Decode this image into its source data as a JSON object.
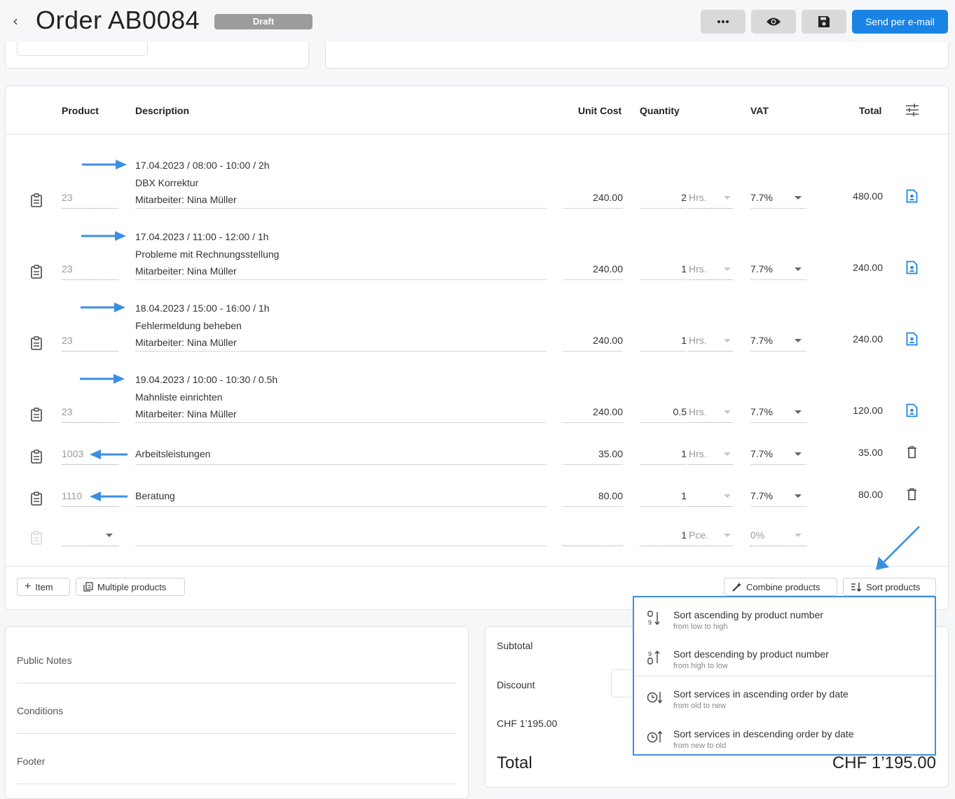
{
  "header": {
    "title": "Order AB0084",
    "status": "Draft",
    "send_label": "Send per e-mail",
    "more_icon": "ellipsis-icon",
    "preview_icon": "eye-icon",
    "save_icon": "floppy-disk-icon"
  },
  "table": {
    "columns": {
      "product": "Product",
      "description": "Description",
      "unit_cost": "Unit Cost",
      "quantity": "Quantity",
      "vat": "VAT",
      "total": "Total"
    },
    "rows": [
      {
        "product": "23",
        "date": "17.04.2023 / 08:00 - 10:00 / 2h",
        "title": "DBX Korrektur",
        "employee": "Mitarbeiter: Nina Müller",
        "unit_cost": "240.00",
        "qty": "2",
        "unit": "Hrs.",
        "vat": "7.7%",
        "total": "480.00"
      },
      {
        "product": "23",
        "date": "17.04.2023 / 11:00 - 12:00 / 1h",
        "title": "Probleme mit Rechnungsstellung",
        "employee": "Mitarbeiter: Nina Müller",
        "unit_cost": "240.00",
        "qty": "1",
        "unit": "Hrs.",
        "vat": "7.7%",
        "total": "240.00"
      },
      {
        "product": "23",
        "date": "18.04.2023 / 15:00 - 16:00 / 1h",
        "title": "Fehlermeldung beheben",
        "employee": "Mitarbeiter: Nina Müller",
        "unit_cost": "240.00",
        "qty": "1",
        "unit": "Hrs.",
        "vat": "7.7%",
        "total": "240.00"
      },
      {
        "product": "23",
        "date": "19.04.2023 / 10:00 - 10:30 / 0.5h",
        "title": "Mahnliste einrichten",
        "employee": "Mitarbeiter: Nina Müller",
        "unit_cost": "240.00",
        "qty": "0.5",
        "unit": "Hrs.",
        "vat": "7.7%",
        "total": "120.00"
      },
      {
        "product": "1003",
        "description": "Arbeitsleistungen",
        "unit_cost": "35.00",
        "qty": "1",
        "unit": "Hrs.",
        "vat": "7.7%",
        "total": "35.00"
      },
      {
        "product": "1110",
        "description": "Beratung",
        "unit_cost": "80.00",
        "qty": "1",
        "unit": "",
        "vat": "7.7%",
        "total": "80.00"
      }
    ],
    "empty_row": {
      "qty": "1",
      "unit": "Pce.",
      "vat": "0%"
    }
  },
  "actions": {
    "item": "Item",
    "multiple": "Multiple products",
    "combine": "Combine products",
    "sort": "Sort products"
  },
  "sort_menu": [
    {
      "label": "Sort ascending by product number",
      "sub": "from low to high"
    },
    {
      "label": "Sort descending by product number",
      "sub": "from high to low"
    },
    {
      "label": "Sort services in ascending order by date",
      "sub": "from old to new"
    },
    {
      "label": "Sort services in descending order by date",
      "sub": "from new to old"
    }
  ],
  "notes": {
    "public_notes": "Public Notes",
    "conditions": "Conditions",
    "footer": "Footer"
  },
  "summary": {
    "subtotal_label": "Subtotal",
    "discount_label": "Discount",
    "vat_line": "CHF 1’195.00",
    "total_label": "Total",
    "total_value": "CHF 1’195.00"
  },
  "colors": {
    "accent": "#1a84e6",
    "annotation": "#3c8fe0"
  }
}
